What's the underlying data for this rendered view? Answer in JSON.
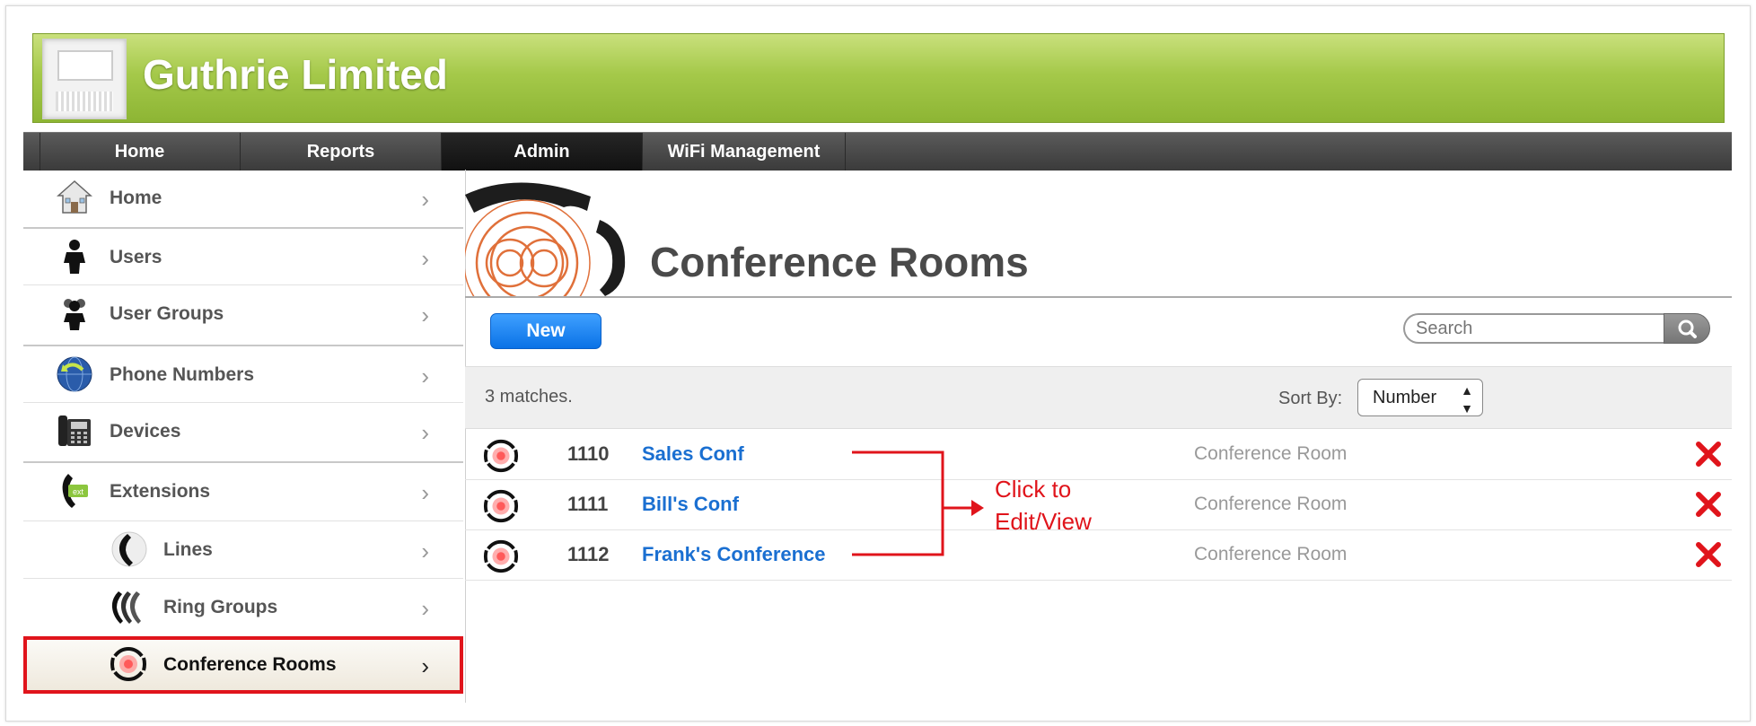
{
  "brand": {
    "title": "Guthrie Limited"
  },
  "topnav": {
    "tabs": [
      {
        "label": "Home"
      },
      {
        "label": "Reports"
      },
      {
        "label": "Admin",
        "active": true
      },
      {
        "label": "WiFi Management"
      }
    ]
  },
  "sidebar": {
    "items": [
      {
        "label": "Home",
        "icon": "house-icon"
      },
      {
        "label": "Users",
        "icon": "user-icon"
      },
      {
        "label": "User Groups",
        "icon": "user-group-icon"
      },
      {
        "label": "Phone Numbers",
        "icon": "globe-phone-icon"
      },
      {
        "label": "Devices",
        "icon": "desk-phone-icon"
      },
      {
        "label": "Extensions",
        "icon": "extension-icon"
      },
      {
        "label": "Lines",
        "icon": "handset-icon"
      },
      {
        "label": "Ring Groups",
        "icon": "ring-group-icon"
      },
      {
        "label": "Conference Rooms",
        "icon": "conference-icon",
        "selected": true
      }
    ],
    "chevron": "›"
  },
  "main": {
    "title": "Conference Rooms",
    "new_button": "New",
    "search": {
      "placeholder": "Search"
    },
    "matches": "3 matches.",
    "sort_label": "Sort By:",
    "sort_value": "Number",
    "rows": [
      {
        "number": "1110",
        "name": "Sales Conf",
        "type": "Conference Room"
      },
      {
        "number": "1111",
        "name": "Bill's Conf",
        "type": "Conference Room"
      },
      {
        "number": "1112",
        "name": "Frank's Conference",
        "type": "Conference Room"
      }
    ]
  },
  "annotation": {
    "line1": "Click to",
    "line2": "Edit/View",
    "color": "#e0141b"
  },
  "colors": {
    "banner": "#a5c94a",
    "link": "#1a6fd1",
    "new_button": "#0a72e6",
    "delete": "#e0141b"
  }
}
